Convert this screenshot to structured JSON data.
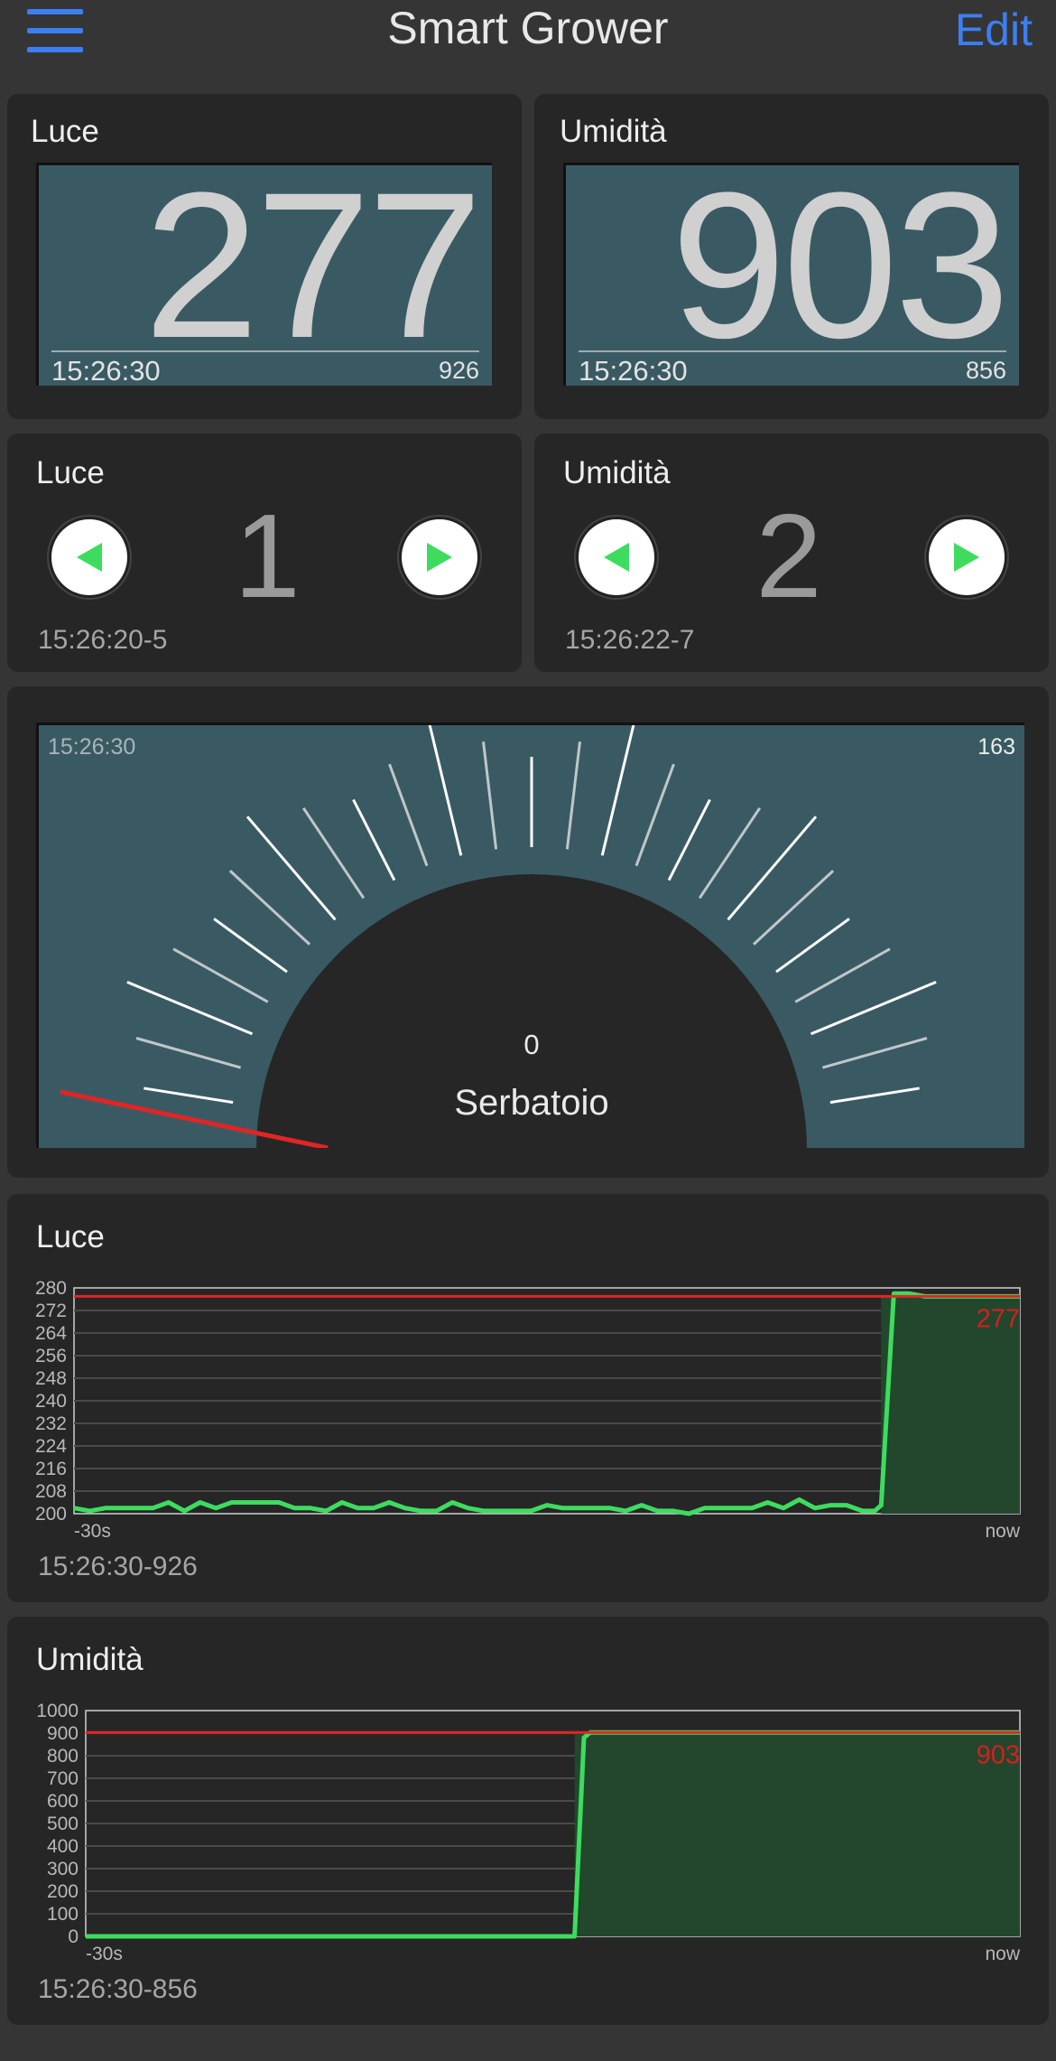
{
  "header": {
    "title": "Smart Grower",
    "edit_label": "Edit"
  },
  "colors": {
    "accent": "#3c7ff2",
    "display_bg": "#3a5a63",
    "panel_bg": "#262626",
    "line_green": "#3ddc5f",
    "limit_red": "#e02525"
  },
  "displays": [
    {
      "label": "Luce",
      "value": "277",
      "time": "15:26:30",
      "side": "926"
    },
    {
      "label": "Umidità",
      "value": "903",
      "time": "15:26:30",
      "side": "856"
    }
  ],
  "steppers": [
    {
      "label": "Luce",
      "value": "1",
      "timestamp": "15:26:20-5",
      "prev_icon": "triangle-left-icon",
      "next_icon": "triangle-right-icon"
    },
    {
      "label": "Umidità",
      "value": "2",
      "timestamp": "15:26:22-7",
      "prev_icon": "triangle-left-icon",
      "next_icon": "triangle-right-icon"
    }
  ],
  "gauge": {
    "time": "15:26:30",
    "max": "163",
    "value": "0",
    "label": "Serbatoio",
    "level": 0
  },
  "charts": [
    {
      "label": "Luce",
      "timestamp": "15:26:30-926",
      "chart_data": {
        "type": "area",
        "y_ticks": [
          "280",
          "272",
          "264",
          "256",
          "248",
          "240",
          "232",
          "224",
          "216",
          "208",
          "200"
        ],
        "ylim": [
          200,
          280
        ],
        "x_start_label": "-30s",
        "x_end_label": "now",
        "limit": 277,
        "last_value_label": "277",
        "x": [
          -30,
          -29.5,
          -29,
          -28.5,
          -28,
          -27.5,
          -27,
          -26.5,
          -26,
          -25.5,
          -25,
          -24.5,
          -24,
          -23.5,
          -23,
          -22.5,
          -22,
          -21.5,
          -21,
          -20.5,
          -20,
          -19.5,
          -19,
          -18.5,
          -18,
          -17.5,
          -17,
          -16.5,
          -16,
          -15.5,
          -15,
          -14.5,
          -14,
          -13.5,
          -13,
          -12.5,
          -12,
          -11.5,
          -11,
          -10.5,
          -10,
          -9.5,
          -9,
          -8.5,
          -8,
          -7.5,
          -7,
          -6.5,
          -6,
          -5.5,
          -5,
          -4.8,
          -4.6,
          -4.4,
          -4,
          -3.5,
          -3,
          -2.5,
          -2,
          -1.5,
          -1,
          -0.5,
          0
        ],
        "values": [
          202,
          201,
          202,
          202,
          202,
          202,
          204,
          201,
          204,
          202,
          204,
          204,
          204,
          204,
          202,
          202,
          201,
          204,
          202,
          202,
          204,
          202,
          201,
          201,
          204,
          202,
          201,
          201,
          201,
          201,
          203,
          202,
          202,
          202,
          202,
          201,
          203,
          201,
          201,
          200,
          202,
          202,
          202,
          202,
          204,
          202,
          205,
          202,
          203,
          203,
          201,
          201,
          201,
          203,
          278,
          278,
          277,
          277,
          277,
          277,
          277,
          277,
          277
        ]
      }
    },
    {
      "label": "Umidità",
      "timestamp": "15:26:30-856",
      "chart_data": {
        "type": "area",
        "y_ticks": [
          "1000",
          "900",
          "800",
          "700",
          "600",
          "500",
          "400",
          "300",
          "200",
          "100",
          "0"
        ],
        "ylim": [
          0,
          1000
        ],
        "x_start_label": "-30s",
        "x_end_label": "now",
        "limit": 903,
        "last_value_label": "903",
        "x": [
          -30,
          -26,
          -22,
          -18,
          -14.3,
          -14,
          -13.8,
          -13,
          -10,
          -6,
          -2,
          0
        ],
        "values": [
          0,
          0,
          0,
          0,
          0,
          880,
          903,
          903,
          903,
          903,
          903,
          903
        ]
      }
    }
  ]
}
